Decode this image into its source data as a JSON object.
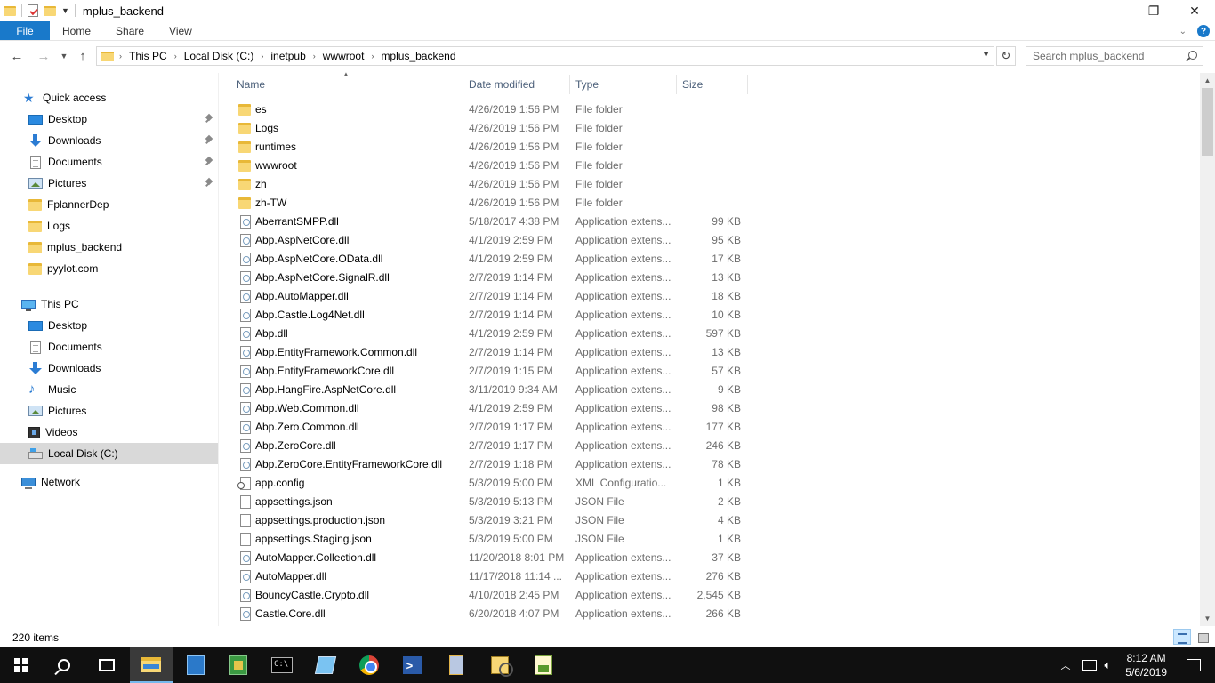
{
  "window": {
    "title": "mplus_backend",
    "controls": {
      "minimize": "—",
      "maximize": "❐",
      "close": "✕"
    }
  },
  "ribbon": {
    "tabs": [
      "File",
      "Home",
      "Share",
      "View"
    ]
  },
  "address": {
    "breadcrumbs": [
      "This PC",
      "Local Disk (C:)",
      "inetpub",
      "wwwroot",
      "mplus_backend"
    ],
    "search_placeholder": "Search mplus_backend"
  },
  "nav": {
    "quick_access": {
      "label": "Quick access",
      "items": [
        {
          "label": "Desktop",
          "icon": "desktop-icon",
          "pinned": true
        },
        {
          "label": "Downloads",
          "icon": "downloads-icon",
          "pinned": true
        },
        {
          "label": "Documents",
          "icon": "documents-icon",
          "pinned": true
        },
        {
          "label": "Pictures",
          "icon": "pictures-icon",
          "pinned": true
        },
        {
          "label": "FplannerDep",
          "icon": "folder-icon",
          "pinned": false
        },
        {
          "label": "Logs",
          "icon": "folder-icon",
          "pinned": false
        },
        {
          "label": "mplus_backend",
          "icon": "folder-icon",
          "pinned": false
        },
        {
          "label": "pyylot.com",
          "icon": "folder-icon",
          "pinned": false
        }
      ]
    },
    "this_pc": {
      "label": "This PC",
      "items": [
        {
          "label": "Desktop",
          "icon": "desktop-icon"
        },
        {
          "label": "Documents",
          "icon": "documents-icon"
        },
        {
          "label": "Downloads",
          "icon": "downloads-icon"
        },
        {
          "label": "Music",
          "icon": "music-icon"
        },
        {
          "label": "Pictures",
          "icon": "pictures-icon"
        },
        {
          "label": "Videos",
          "icon": "videos-icon"
        },
        {
          "label": "Local Disk (C:)",
          "icon": "local-disk-icon",
          "selected": true
        }
      ]
    },
    "network": {
      "label": "Network"
    }
  },
  "columns": [
    "Name",
    "Date modified",
    "Type",
    "Size"
  ],
  "files": [
    {
      "name": "es",
      "date": "4/26/2019 1:56 PM",
      "type": "File folder",
      "size": "",
      "kind": "folder"
    },
    {
      "name": "Logs",
      "date": "4/26/2019 1:56 PM",
      "type": "File folder",
      "size": "",
      "kind": "folder"
    },
    {
      "name": "runtimes",
      "date": "4/26/2019 1:56 PM",
      "type": "File folder",
      "size": "",
      "kind": "folder"
    },
    {
      "name": "wwwroot",
      "date": "4/26/2019 1:56 PM",
      "type": "File folder",
      "size": "",
      "kind": "folder"
    },
    {
      "name": "zh",
      "date": "4/26/2019 1:56 PM",
      "type": "File folder",
      "size": "",
      "kind": "folder"
    },
    {
      "name": "zh-TW",
      "date": "4/26/2019 1:56 PM",
      "type": "File folder",
      "size": "",
      "kind": "folder"
    },
    {
      "name": "AberrantSMPP.dll",
      "date": "5/18/2017 4:38 PM",
      "type": "Application extens...",
      "size": "99 KB",
      "kind": "dll"
    },
    {
      "name": "Abp.AspNetCore.dll",
      "date": "4/1/2019 2:59 PM",
      "type": "Application extens...",
      "size": "95 KB",
      "kind": "dll"
    },
    {
      "name": "Abp.AspNetCore.OData.dll",
      "date": "4/1/2019 2:59 PM",
      "type": "Application extens...",
      "size": "17 KB",
      "kind": "dll"
    },
    {
      "name": "Abp.AspNetCore.SignalR.dll",
      "date": "2/7/2019 1:14 PM",
      "type": "Application extens...",
      "size": "13 KB",
      "kind": "dll"
    },
    {
      "name": "Abp.AutoMapper.dll",
      "date": "2/7/2019 1:14 PM",
      "type": "Application extens...",
      "size": "18 KB",
      "kind": "dll"
    },
    {
      "name": "Abp.Castle.Log4Net.dll",
      "date": "2/7/2019 1:14 PM",
      "type": "Application extens...",
      "size": "10 KB",
      "kind": "dll"
    },
    {
      "name": "Abp.dll",
      "date": "4/1/2019 2:59 PM",
      "type": "Application extens...",
      "size": "597 KB",
      "kind": "dll"
    },
    {
      "name": "Abp.EntityFramework.Common.dll",
      "date": "2/7/2019 1:14 PM",
      "type": "Application extens...",
      "size": "13 KB",
      "kind": "dll"
    },
    {
      "name": "Abp.EntityFrameworkCore.dll",
      "date": "2/7/2019 1:15 PM",
      "type": "Application extens...",
      "size": "57 KB",
      "kind": "dll"
    },
    {
      "name": "Abp.HangFire.AspNetCore.dll",
      "date": "3/11/2019 9:34 AM",
      "type": "Application extens...",
      "size": "9 KB",
      "kind": "dll"
    },
    {
      "name": "Abp.Web.Common.dll",
      "date": "4/1/2019 2:59 PM",
      "type": "Application extens...",
      "size": "98 KB",
      "kind": "dll"
    },
    {
      "name": "Abp.Zero.Common.dll",
      "date": "2/7/2019 1:17 PM",
      "type": "Application extens...",
      "size": "177 KB",
      "kind": "dll"
    },
    {
      "name": "Abp.ZeroCore.dll",
      "date": "2/7/2019 1:17 PM",
      "type": "Application extens...",
      "size": "246 KB",
      "kind": "dll"
    },
    {
      "name": "Abp.ZeroCore.EntityFrameworkCore.dll",
      "date": "2/7/2019 1:18 PM",
      "type": "Application extens...",
      "size": "78 KB",
      "kind": "dll"
    },
    {
      "name": "app.config",
      "date": "5/3/2019 5:00 PM",
      "type": "XML Configuratio...",
      "size": "1 KB",
      "kind": "config"
    },
    {
      "name": "appsettings.json",
      "date": "5/3/2019 5:13 PM",
      "type": "JSON File",
      "size": "2 KB",
      "kind": "json"
    },
    {
      "name": "appsettings.production.json",
      "date": "5/3/2019 3:21 PM",
      "type": "JSON File",
      "size": "4 KB",
      "kind": "json"
    },
    {
      "name": "appsettings.Staging.json",
      "date": "5/3/2019 5:00 PM",
      "type": "JSON File",
      "size": "1 KB",
      "kind": "json"
    },
    {
      "name": "AutoMapper.Collection.dll",
      "date": "11/20/2018 8:01 PM",
      "type": "Application extens...",
      "size": "37 KB",
      "kind": "dll"
    },
    {
      "name": "AutoMapper.dll",
      "date": "11/17/2018 11:14 ...",
      "type": "Application extens...",
      "size": "276 KB",
      "kind": "dll"
    },
    {
      "name": "BouncyCastle.Crypto.dll",
      "date": "4/10/2018 2:45 PM",
      "type": "Application extens...",
      "size": "2,545 KB",
      "kind": "dll"
    },
    {
      "name": "Castle.Core.dll",
      "date": "6/20/2018 4:07 PM",
      "type": "Application extens...",
      "size": "266 KB",
      "kind": "dll"
    }
  ],
  "status": {
    "item_count": "220 items"
  },
  "taskbar": {
    "apps": [
      "start-icon",
      "search-icon",
      "task-view-icon",
      "file-explorer-icon",
      "server-manager-icon",
      "iis-manager-icon",
      "command-prompt-icon",
      "notepad-icon",
      "chrome-icon",
      "powershell-icon",
      "tool-icon",
      "tool-icon",
      "tool-icon"
    ],
    "time": "8:12 AM",
    "date": "5/6/2019"
  },
  "colors": {
    "accent": "#1979ca",
    "selected_nav": "#d9d9d9",
    "header_text": "#4c607a",
    "muted_text": "#6d6d6d",
    "taskbar": "#101010"
  }
}
